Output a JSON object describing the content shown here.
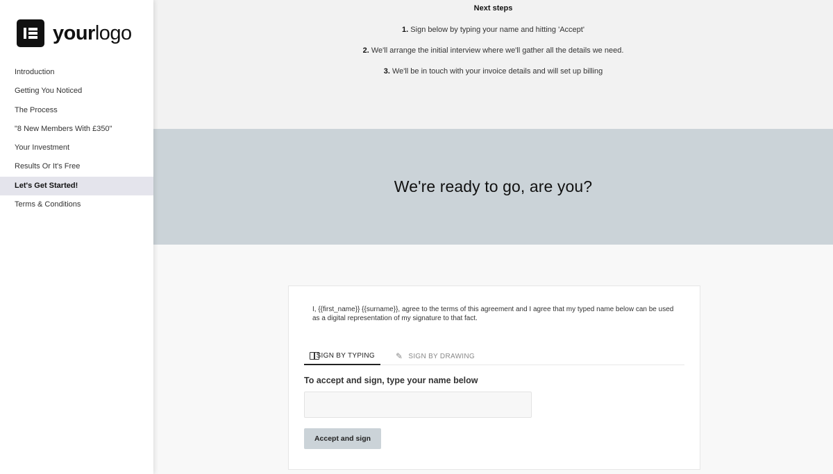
{
  "brand": {
    "logo_bold": "your",
    "logo_light": "logo",
    "logo_icon": "elementor-logo-icon"
  },
  "sidebar": {
    "items": [
      {
        "label": "Introduction",
        "active": false
      },
      {
        "label": "Getting You Noticed",
        "active": false
      },
      {
        "label": "The Process",
        "active": false
      },
      {
        "label": "\"8 New Members With £350\"",
        "active": false
      },
      {
        "label": "Your Investment",
        "active": false
      },
      {
        "label": "Results Or It's Free",
        "active": false
      },
      {
        "label": "Let's Get Started!",
        "active": true
      },
      {
        "label": "Terms & Conditions",
        "active": false
      }
    ]
  },
  "next_steps": {
    "title": "Next steps",
    "steps": [
      {
        "num": "1.",
        "text": "Sign below by typing your name and hitting 'Accept'"
      },
      {
        "num": "2.",
        "text": "We'll arrange the initial interview where we'll gather all the details we need."
      },
      {
        "num": "3.",
        "text": "We'll be in touch with your invoice details and will set up billing"
      }
    ]
  },
  "banner": {
    "title": "We're ready to go, are you?"
  },
  "signature": {
    "agreement_text": "I, {{first_name}} {{surname}}, agree to the terms of this agreement and I agree that my typed name below can be used as a digital representation of my signature to that fact.",
    "tabs": [
      {
        "label": "SIGN BY TYPING",
        "icon": "book-icon",
        "active": true
      },
      {
        "label": "SIGN BY DRAWING",
        "icon": "pen-icon",
        "active": false
      }
    ],
    "prompt": "To accept and sign, type your name below",
    "name_value": "",
    "name_placeholder": "",
    "accept_label": "Accept and sign"
  },
  "colors": {
    "banner_bg": "#cbd3d8",
    "active_nav_bg": "#e4e4ec",
    "page_bg": "#f2f2f2",
    "button_bg": "#cbd3d8"
  }
}
